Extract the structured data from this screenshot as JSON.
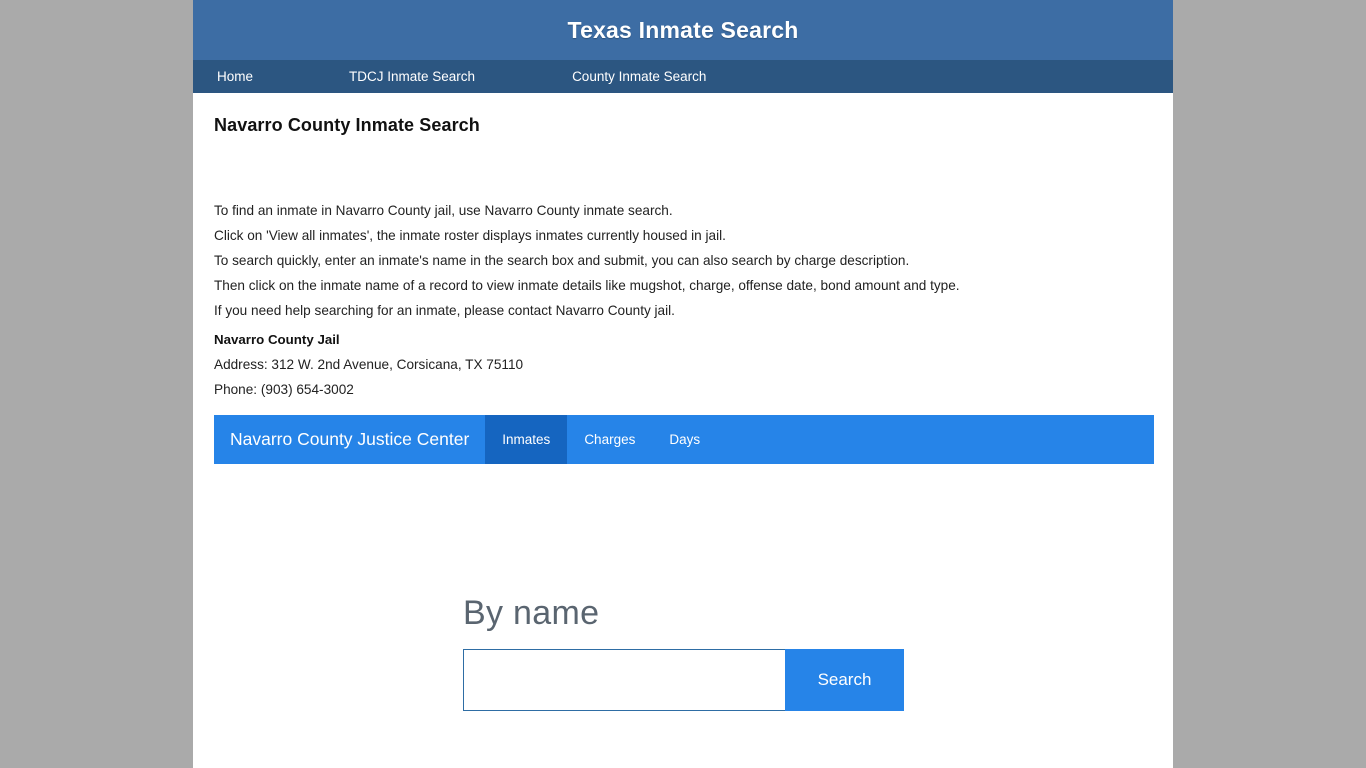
{
  "header": {
    "site_title": "Texas Inmate Search",
    "bg_color": "#3d6da4"
  },
  "nav": {
    "bg_color": "#2c5681",
    "items": [
      {
        "label": "Home"
      },
      {
        "label": "TDCJ Inmate Search"
      },
      {
        "label": "County Inmate Search"
      }
    ]
  },
  "main": {
    "page_heading": "Navarro County Inmate Search",
    "intro_lines": [
      "To find an inmate in Navarro County jail, use Navarro County inmate search.",
      "Click on 'View all inmates', the inmate roster displays inmates currently housed in jail.",
      "To search quickly, enter an inmate's name in the search box and submit, you can also search by charge description.",
      "Then click on the inmate name of a record to view inmate details like mugshot, charge, offense date, bond amount and type.",
      "If you need help searching for an inmate, please contact Navarro County jail."
    ],
    "jail": {
      "name": "Navarro County Jail",
      "address": "Address: 312 W. 2nd Avenue, Corsicana, TX 75110",
      "phone": "Phone: (903) 654-3002"
    }
  },
  "widget": {
    "brand": "Navarro County Justice Center",
    "bar_color": "#2684e8",
    "active_tab_color": "#1565c0",
    "tabs": [
      {
        "label": "Inmates",
        "active": true
      },
      {
        "label": "Charges",
        "active": false
      },
      {
        "label": "Days",
        "active": false
      }
    ],
    "search": {
      "label": "By name",
      "input_value": "",
      "input_placeholder": "",
      "button_label": "Search"
    }
  }
}
